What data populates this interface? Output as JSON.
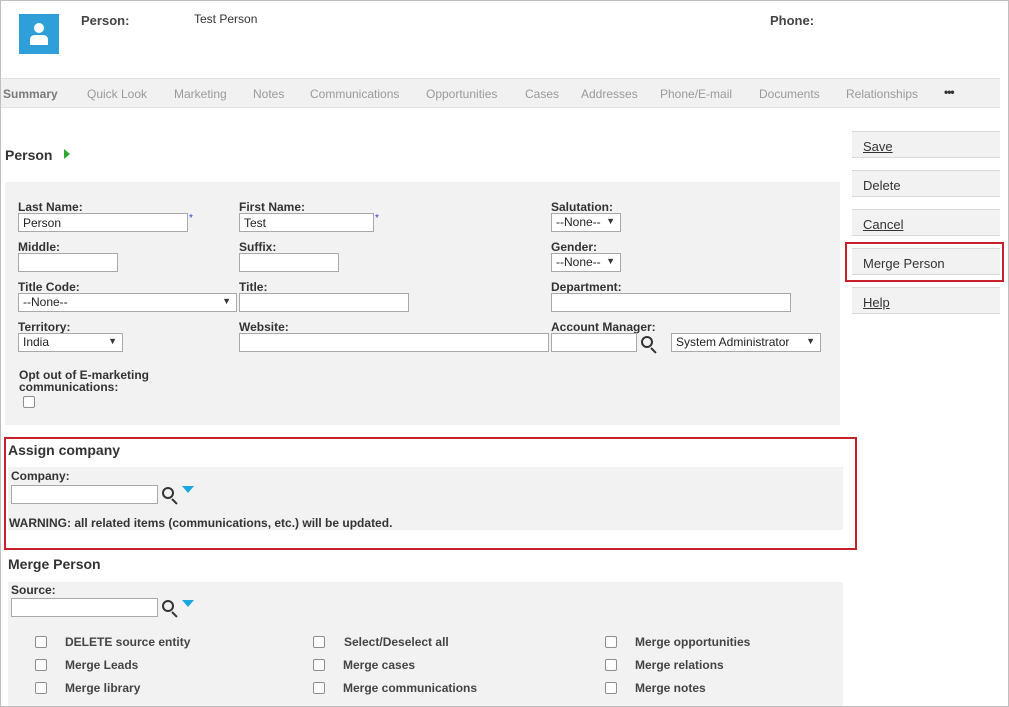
{
  "header": {
    "person_label": "Person:",
    "person_value": "Test Person",
    "phone_label": "Phone:"
  },
  "tabs": [
    {
      "label": "Summary"
    },
    {
      "label": "Quick Look"
    },
    {
      "label": "Marketing"
    },
    {
      "label": "Notes"
    },
    {
      "label": "Communications"
    },
    {
      "label": "Opportunities"
    },
    {
      "label": "Cases"
    },
    {
      "label": "Addresses"
    },
    {
      "label": "Phone/E-mail"
    },
    {
      "label": "Documents"
    },
    {
      "label": "Relationships"
    }
  ],
  "tabs_more": "•••",
  "person_section": {
    "title": "Person",
    "last_name_label": "Last Name:",
    "last_name_value": "Person",
    "first_name_label": "First Name:",
    "first_name_value": "Test",
    "required_mark": "*",
    "salutation_label": "Salutation:",
    "salutation_value": "--None--",
    "middle_label": "Middle:",
    "suffix_label": "Suffix:",
    "gender_label": "Gender:",
    "gender_value": "--None--",
    "title_code_label": "Title Code:",
    "title_code_value": "--None--",
    "title_label": "Title:",
    "department_label": "Department:",
    "territory_label": "Territory:",
    "territory_value": "India",
    "website_label": "Website:",
    "account_manager_label": "Account Manager:",
    "account_manager_value": "System Administrator",
    "opt_out_label_1": "Opt out of E-marketing",
    "opt_out_label_2": "communications:"
  },
  "assign_company": {
    "title": "Assign company",
    "company_label": "Company:",
    "warning": "WARNING: all related items (communications, etc.) will be updated."
  },
  "merge_person": {
    "title": "Merge Person",
    "source_label": "Source:",
    "options": [
      {
        "label": "DELETE source entity"
      },
      {
        "label": "Select/Deselect all"
      },
      {
        "label": "Merge opportunities"
      },
      {
        "label": "Merge Leads"
      },
      {
        "label": "Merge cases"
      },
      {
        "label": "Merge relations"
      },
      {
        "label": "Merge library"
      },
      {
        "label": "Merge communications"
      },
      {
        "label": "Merge notes"
      }
    ]
  },
  "actions": {
    "save": "Save",
    "delete": "Delete",
    "cancel": "Cancel",
    "merge_person": "Merge Person",
    "help": "Help"
  },
  "colors": {
    "accent": "#2e9fd8",
    "highlight_border": "#c8202a",
    "panel_bg": "#f2f2f2",
    "required": "#2b3bd1",
    "arrow_green": "#2fa82f"
  }
}
